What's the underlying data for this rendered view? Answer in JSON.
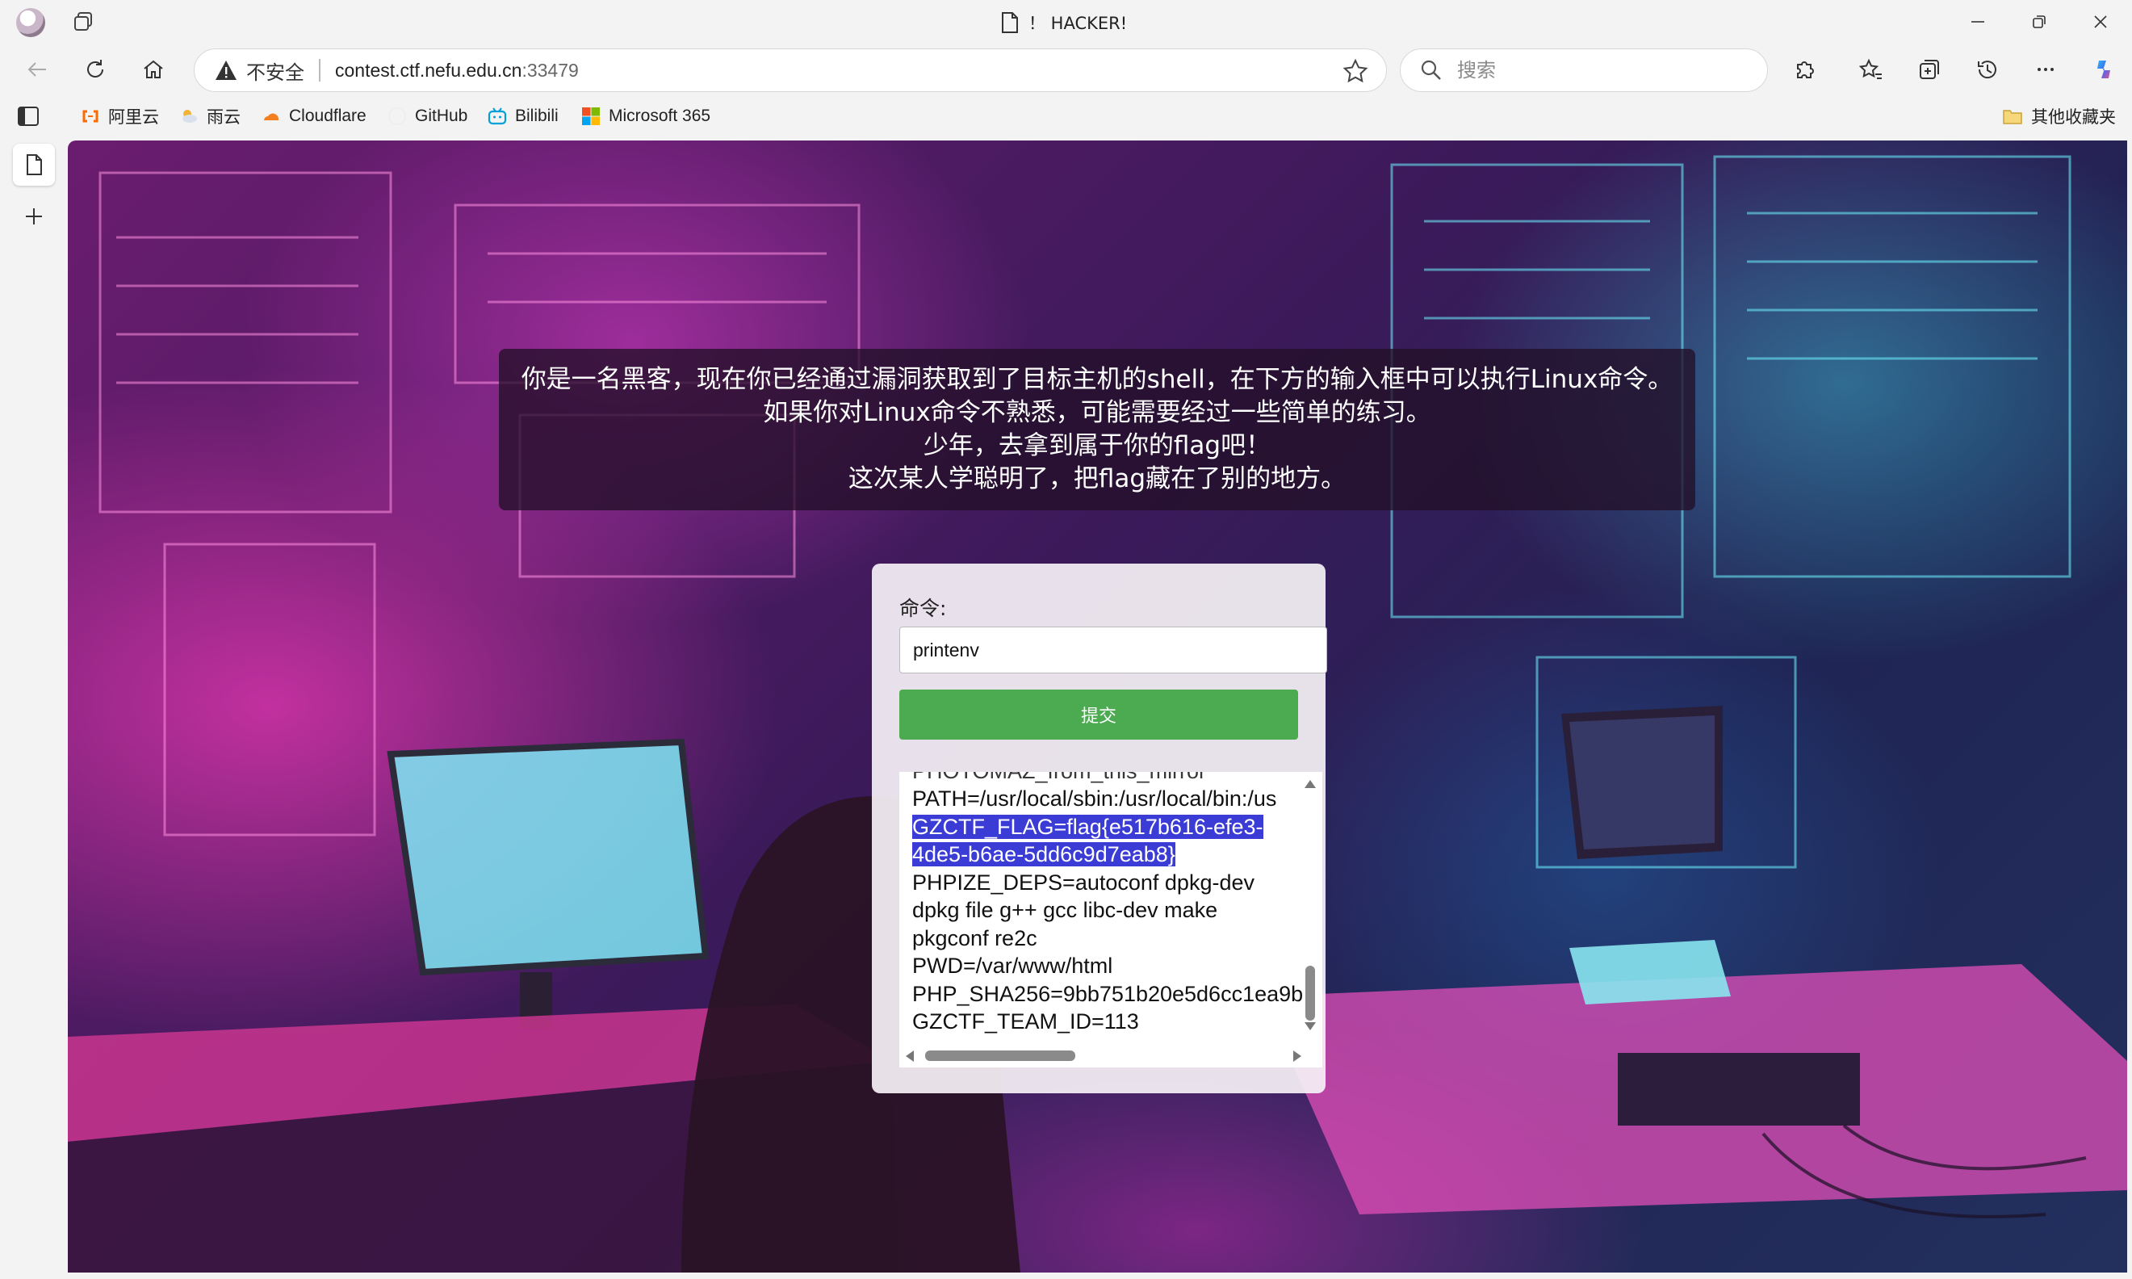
{
  "window": {
    "title": "！ HACKER!"
  },
  "toolbar": {
    "security_label": "不安全",
    "url_host": "contest.ctf.nefu.edu.cn",
    "url_port": ":33479",
    "search_placeholder": "搜索"
  },
  "bookmarks": {
    "items": [
      {
        "label": "阿里云",
        "icon": "aliyun-icon",
        "color": "#ff6a00"
      },
      {
        "label": "雨云",
        "icon": "rainyun-icon",
        "color": "#f2b233"
      },
      {
        "label": "Cloudflare",
        "icon": "cloudflare-icon",
        "color": "#f38020"
      },
      {
        "label": "GitHub",
        "icon": "github-icon",
        "color": "#222222"
      },
      {
        "label": "Bilibili",
        "icon": "bilibili-icon",
        "color": "#00a1d6"
      },
      {
        "label": "Microsoft 365",
        "icon": "microsoft-icon",
        "color": "#f25022"
      }
    ],
    "other_label": "其他收藏夹"
  },
  "page": {
    "intro_lines": [
      "你是一名黑客，现在你已经通过漏洞获取到了目标主机的shell，在下方的输入框中可以执行Linux命令。",
      "如果你对Linux命令不熟悉，可能需要经过一些简单的练习。",
      "少年，去拿到属于你的flag吧！",
      "这次某人学聪明了，把flag藏在了别的地方。"
    ],
    "command_label": "命令:",
    "command_value": "printenv",
    "submit_label": "提交",
    "output": {
      "partial_top": "PHOTOMAZ_from_this_mirror",
      "path_line": "PATH=/usr/local/sbin:/usr/local/bin:/us",
      "flag_line_1": "GZCTF_FLAG=flag{e517b616-efe3-",
      "flag_line_2": "4de5-b6ae-5dd6c9d7eab8}",
      "phpize_1": "PHPIZE_DEPS=autoconf dpkg-dev",
      "phpize_2": "dpkg file g++ gcc libc-dev make",
      "phpize_3": "pkgconf re2c",
      "pwd": "PWD=/var/www/html",
      "sha": "PHP_SHA256=9bb751b20e5d6cc1ea9b",
      "team": "GZCTF_TEAM_ID=113"
    }
  },
  "colors": {
    "submit_button": "#4caa50",
    "selection": "#3b3bd6",
    "intro_bg": "rgba(35,15,40,.78)"
  }
}
